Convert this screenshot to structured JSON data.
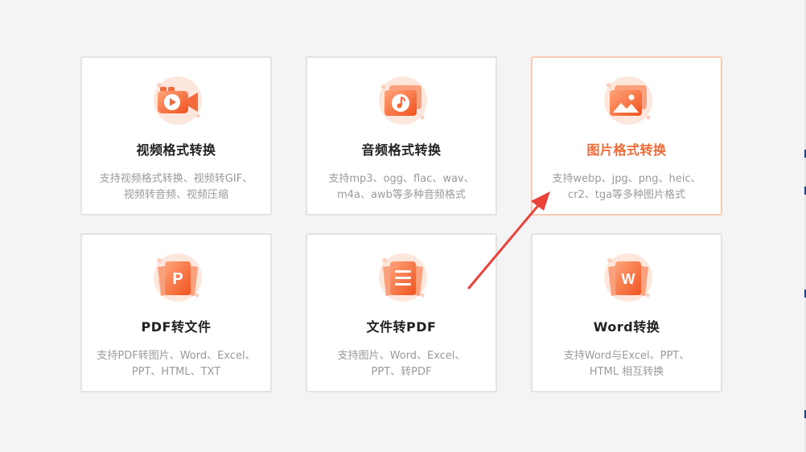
{
  "cards": [
    {
      "title": "视频格式转换",
      "desc_line1": "支持视频格式转换、视频转GIF、",
      "desc_line2": "视频转音频、视频压缩",
      "icon": "video-camera-icon"
    },
    {
      "title": "音频格式转换",
      "desc_line1": "支持mp3、ogg、flac、wav、",
      "desc_line2": "m4a、awb等多种音频格式",
      "icon": "music-note-icon"
    },
    {
      "title": "图片格式转换",
      "desc_line1": "支持webp、jpg、png、heic、",
      "desc_line2": "cr2、tga等多种图片格式",
      "icon": "image-icon"
    },
    {
      "title": "PDF转文件",
      "desc_line1": "支持PDF转图片、Word、Excel、",
      "desc_line2": "PPT、HTML、TXT",
      "icon": "pdf-file-icon",
      "icon_letter": "P"
    },
    {
      "title": "文件转PDF",
      "desc_line1": "支持图片、Word、Excel、",
      "desc_line2": "PPT、转PDF",
      "icon": "document-lines-icon"
    },
    {
      "title": "Word转换",
      "desc_line1": "支持Word与Excel、PPT、",
      "desc_line2": "HTML 相互转换",
      "icon": "word-file-icon",
      "icon_letter": "W"
    }
  ],
  "colors": {
    "accent": "#f06a35",
    "icon_gradient_start": "#ff9a6b",
    "icon_gradient_end": "#f25a2a",
    "annotation_arrow": "#e8423a"
  }
}
